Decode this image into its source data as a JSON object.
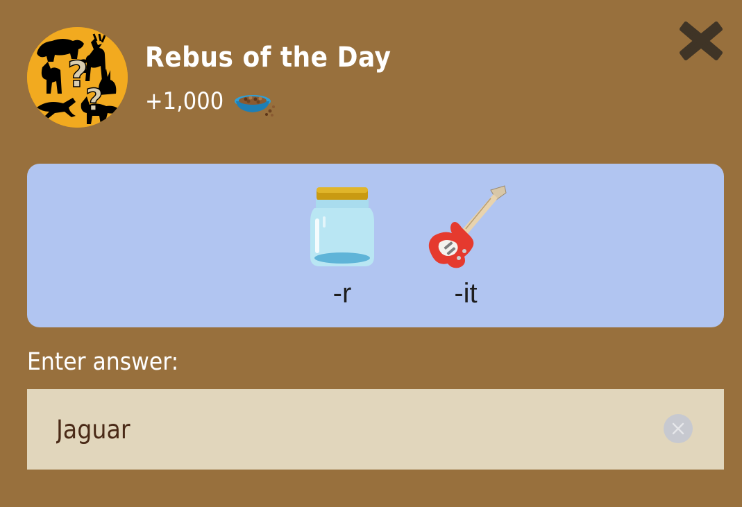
{
  "header": {
    "title": "Rebus of the Day",
    "reward_amount": "+1,000",
    "reward_icon": "pet-food-bowl-icon",
    "avatar_icon": "animal-silhouettes-question-icon",
    "close_icon": "close-x-icon"
  },
  "puzzle": {
    "clues": [
      {
        "icon": "jar-icon",
        "label": "-r"
      },
      {
        "icon": "electric-guitar-icon",
        "label": "-it"
      }
    ]
  },
  "answer": {
    "label": "Enter answer:",
    "value": "Jaguar",
    "clear_icon": "clear-circle-icon"
  },
  "colors": {
    "background": "#98703d",
    "panel": "#b1c5f1",
    "input_background": "#e1d6bc",
    "avatar_background": "#f2aa1f",
    "close_icon": "#3f3426"
  }
}
